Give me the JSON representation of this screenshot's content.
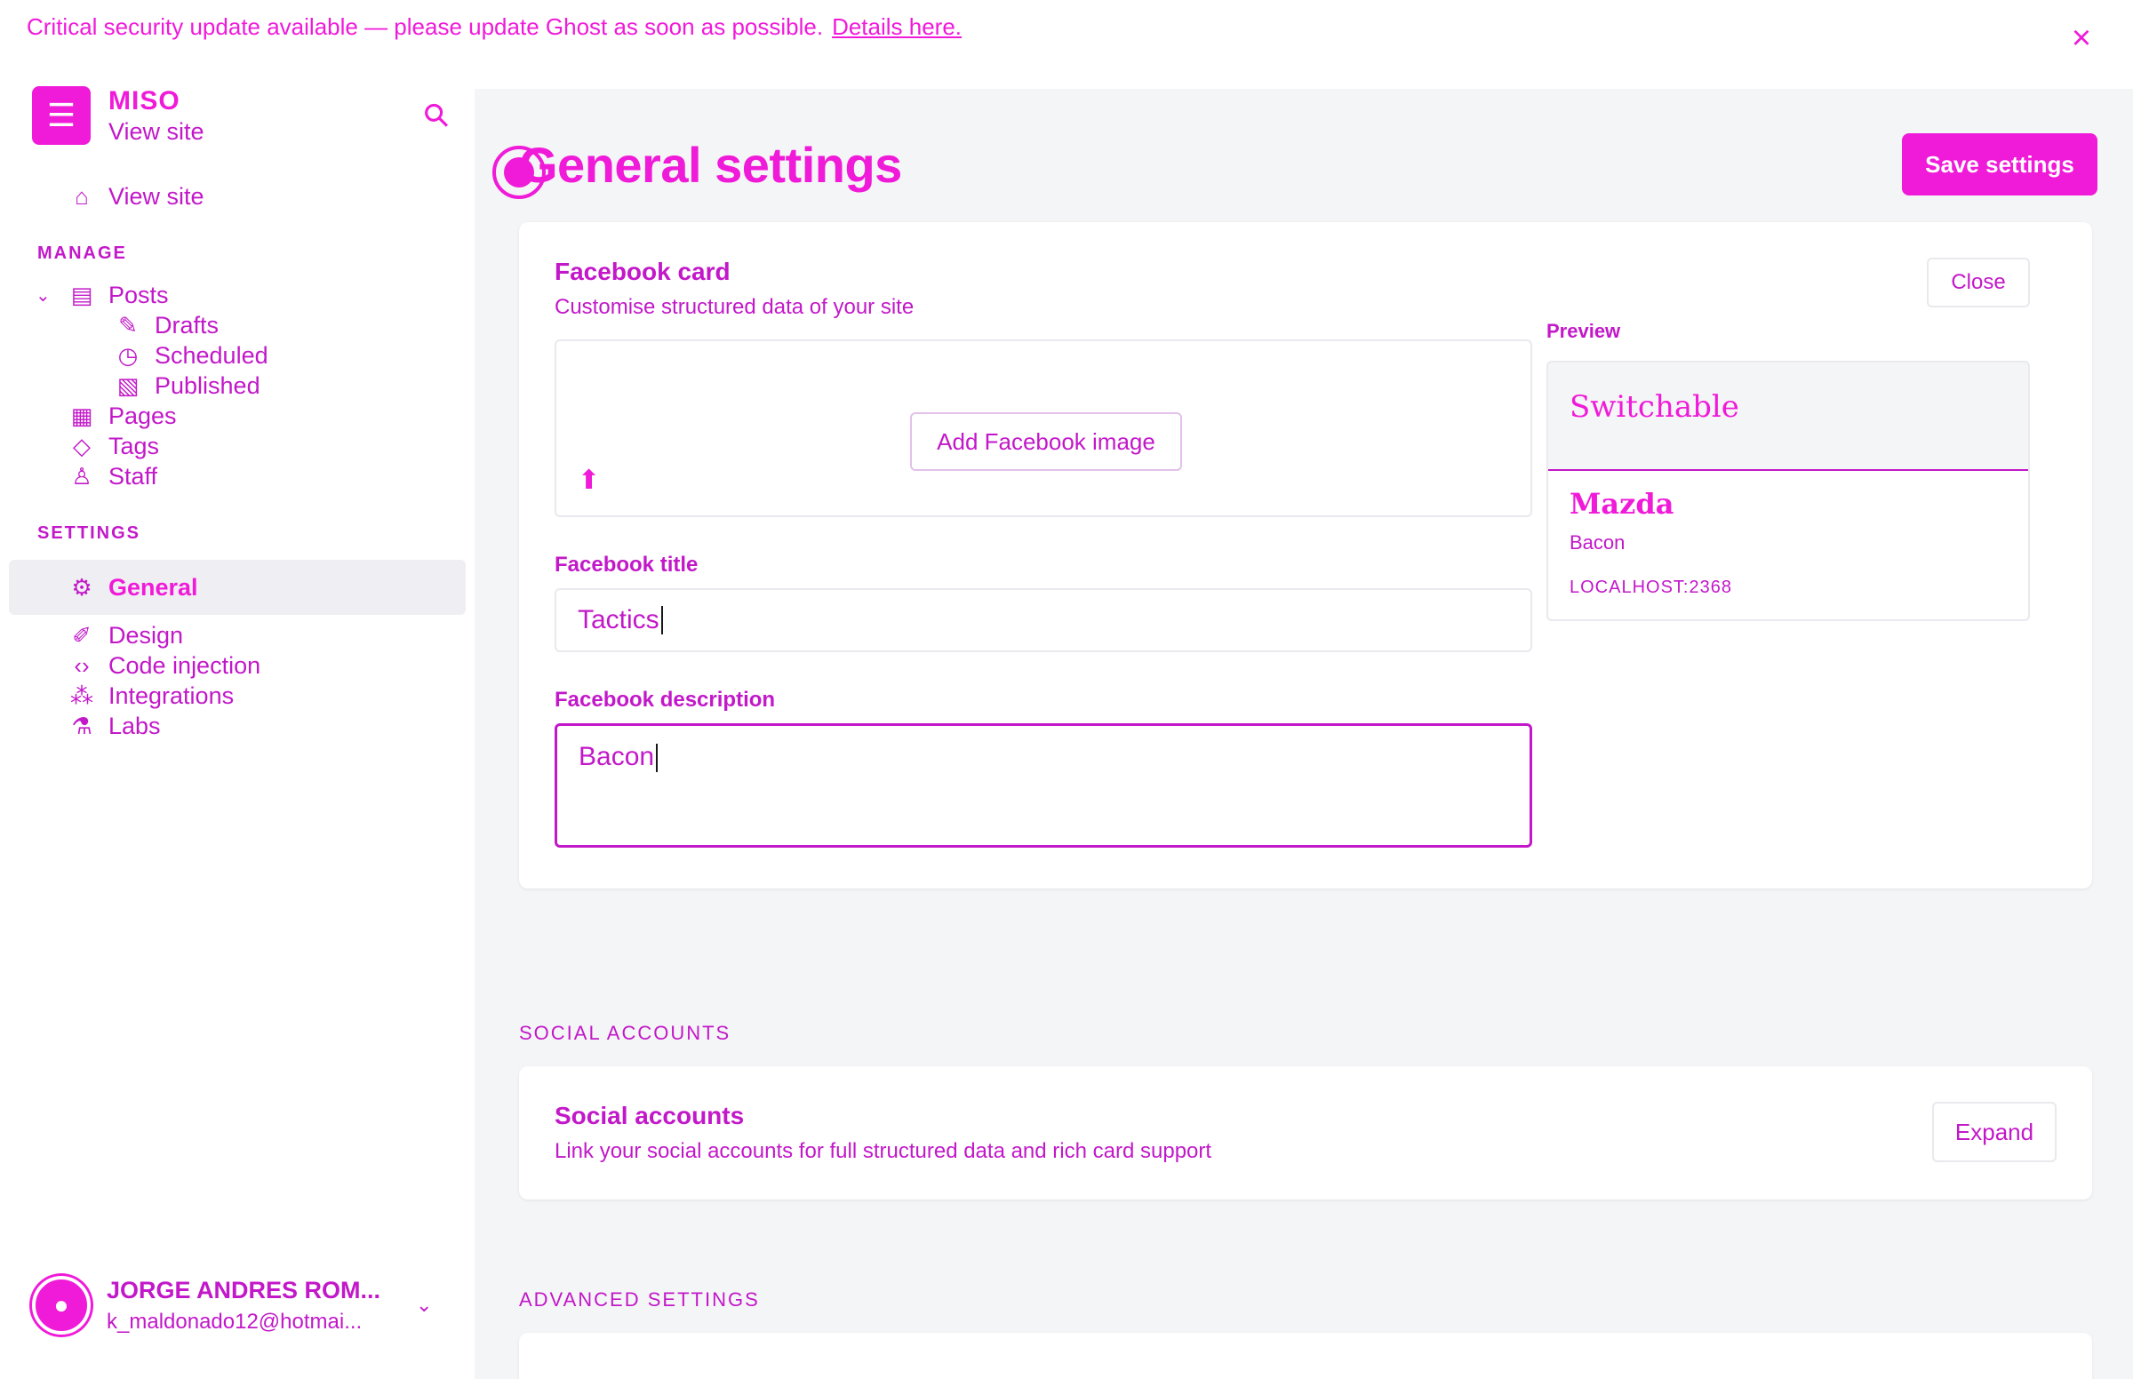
{
  "banner": {
    "text": "Critical security update available — please update Ghost as soon as possible.",
    "link": "Details here.",
    "close_icon": "close-icon"
  },
  "sidebar": {
    "brand": {
      "name": "MISO",
      "view_site": "View site",
      "logo_icon": "ghost-logo-icon",
      "search_icon": "search-icon"
    },
    "top_link": {
      "label": "View site",
      "icon": "home-icon"
    },
    "manage_heading": "MANAGE",
    "manage_items": [
      {
        "label": "Posts",
        "icon": "posts-icon"
      },
      {
        "label": "Drafts",
        "icon": "pencil-icon"
      },
      {
        "label": "Scheduled",
        "icon": "clock-icon"
      },
      {
        "label": "Published",
        "icon": "published-icon"
      },
      {
        "label": "Pages",
        "icon": "pages-icon"
      },
      {
        "label": "Tags",
        "icon": "tag-icon"
      },
      {
        "label": "Staff",
        "icon": "staff-icon"
      }
    ],
    "settings_heading": "SETTINGS",
    "settings_items": [
      {
        "label": "General",
        "icon": "gear-icon"
      },
      {
        "label": "Design",
        "icon": "brush-icon"
      },
      {
        "label": "Code injection",
        "icon": "code-icon"
      },
      {
        "label": "Integrations",
        "icon": "integrations-icon"
      },
      {
        "label": "Labs",
        "icon": "flask-icon"
      }
    ],
    "user": {
      "name": "JORGE ANDRES ROM...",
      "email": "k_maldonado12@hotmai..."
    }
  },
  "main": {
    "title": "General settings",
    "save_label": "Save settings",
    "facebook": {
      "title": "Facebook card",
      "subtitle": "Customise structured data of your site",
      "add_image_label": "Add Facebook image",
      "title_label": "Facebook title",
      "title_value": "Tactics",
      "description_label": "Facebook description",
      "description_value": "Bacon"
    },
    "preview": {
      "close_label": "Close",
      "label": "Preview",
      "image_title": "Switchable",
      "title": "Mazda",
      "description": "Bacon",
      "host": "LOCALHOST:2368"
    },
    "social_heading": "SOCIAL ACCOUNTS",
    "social": {
      "title": "Social accounts",
      "subtitle": "Link your social accounts for full structured data and rich card support",
      "expand_label": "Expand"
    },
    "advanced_heading": "ADVANCED SETTINGS"
  },
  "colors": {
    "accent": "#f01ad9",
    "text": "#c218c9",
    "bg": "#f4f5f6"
  }
}
